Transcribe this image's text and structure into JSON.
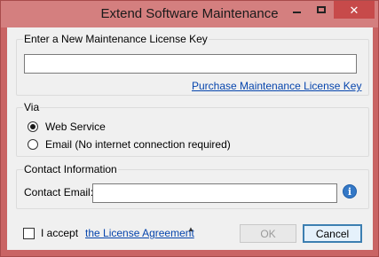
{
  "window": {
    "title": "Extend Software Maintenance",
    "controls": {
      "close_glyph": "✕"
    }
  },
  "license_group": {
    "legend": "Enter a New Maintenance License Key",
    "key_value": "",
    "purchase_link": "Purchase Maintenance License Key"
  },
  "via_group": {
    "legend": "Via",
    "options": [
      {
        "label": "Web Service",
        "selected": true
      },
      {
        "label": "Email (No internet connection required)",
        "selected": false
      }
    ]
  },
  "contact_group": {
    "legend": "Contact Information",
    "email_label": "Contact Email:",
    "email_value": "",
    "info_glyph": "i"
  },
  "footer": {
    "accept_label": "I accept",
    "agreement_link": "the License Agreement",
    "caret_glyph": "▲",
    "accepted": false,
    "ok_label": "OK",
    "ok_enabled": false,
    "cancel_label": "Cancel"
  },
  "colors": {
    "window_frame": "#c96464",
    "close_button": "#c74a4a",
    "link": "#0645ad",
    "info_icon": "#3478c6",
    "cancel_focus_border": "#3c7fb1"
  }
}
